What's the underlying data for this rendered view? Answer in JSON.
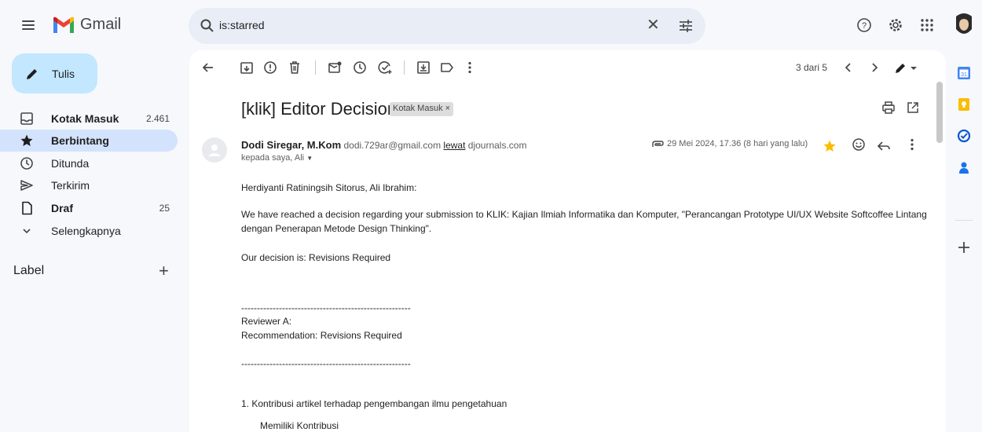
{
  "app": {
    "name": "Gmail"
  },
  "search": {
    "query": "is:starred"
  },
  "compose": {
    "label": "Tulis"
  },
  "sidebar": {
    "items": [
      {
        "label": "Kotak Masuk",
        "count": "2.461",
        "bold": true,
        "icon": "inbox-icon"
      },
      {
        "label": "Berbintang",
        "count": "",
        "bold": true,
        "icon": "star-icon"
      },
      {
        "label": "Ditunda",
        "count": "",
        "bold": false,
        "icon": "clock-icon"
      },
      {
        "label": "Terkirim",
        "count": "",
        "bold": false,
        "icon": "send-icon"
      },
      {
        "label": "Draf",
        "count": "25",
        "bold": true,
        "icon": "draft-icon"
      },
      {
        "label": "Selengkapnya",
        "count": "",
        "bold": false,
        "icon": "chevron-down-icon"
      }
    ],
    "label_heading": "Label",
    "label_add": "+"
  },
  "toolbar": {
    "pager": "3 dari 5"
  },
  "email": {
    "subject": "[klik] Editor Decision",
    "label_chip": "Kotak Masuk ×",
    "sender_name": "Dodi Siregar, M.Kom",
    "sender_email": "dodi.729ar@gmail.com",
    "via_word": "lewat",
    "via_domain": "djournals.com",
    "to": "kepada saya, Ali",
    "date": "29 Mei 2024, 17.36 (8 hari yang lalu)",
    "body": {
      "greeting": "Herdiyanti Ratiningsih Sitorus, Ali Ibrahim:",
      "para1_line1": "We have reached a decision regarding your submission to KLIK: Kajian Ilmiah Informatika dan Komputer, \"Perancangan Prototype UI/UX Website Softcoffee Lintang",
      "para1_line2": "dengan Penerapan Metode Design Thinking\".",
      "decision": "Our decision is: Revisions Required",
      "separator1": "------------------------------------------------------",
      "reviewer": "Reviewer A:",
      "recommendation": "Recommendation: Revisions Required",
      "separator2": "------------------------------------------------------",
      "item1": "1. Kontribusi artikel terhadap pengembangan ilmu pengetahuan",
      "item1_answer": "Memiliki Kontribusi"
    }
  },
  "colors": {
    "accent": "#0b57d0",
    "star": "#fbbc04",
    "active_nav": "#d3e3fd",
    "compose": "#c2e7ff"
  }
}
